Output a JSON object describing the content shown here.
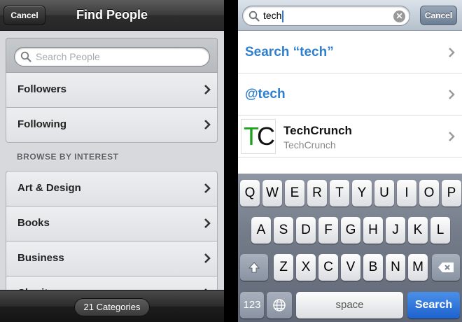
{
  "left": {
    "nav": {
      "cancel_label": "Cancel",
      "title": "Find People"
    },
    "search": {
      "placeholder": "Search People"
    },
    "top_rows": [
      {
        "label": "Followers"
      },
      {
        "label": "Following"
      }
    ],
    "section_header": "BROWSE BY INTEREST",
    "interest_rows": [
      {
        "label": "Art & Design"
      },
      {
        "label": "Books"
      },
      {
        "label": "Business"
      },
      {
        "label": "Charity"
      }
    ],
    "bottom": {
      "categories_badge": "21 Categories"
    }
  },
  "right": {
    "search": {
      "value": "tech",
      "cancel_label": "Cancel"
    },
    "results": {
      "search_label": "Search “tech”",
      "handle_label": "@tech",
      "account": {
        "name": "TechCrunch",
        "subtitle": "TechCrunch",
        "logo_t": "T",
        "logo_c": "C"
      }
    },
    "keyboard": {
      "row1": [
        "Q",
        "W",
        "E",
        "R",
        "T",
        "Y",
        "U",
        "I",
        "O",
        "P"
      ],
      "row2": [
        "A",
        "S",
        "D",
        "F",
        "G",
        "H",
        "J",
        "K",
        "L"
      ],
      "row3": [
        "Z",
        "X",
        "C",
        "V",
        "B",
        "N",
        "M"
      ],
      "numbers_label": "123",
      "space_label": "space",
      "search_label": "Search"
    }
  },
  "colors": {
    "link_blue": "#2f7fcf",
    "search_key_blue": "#1d62cf",
    "logo_green": "#1ca21c"
  }
}
